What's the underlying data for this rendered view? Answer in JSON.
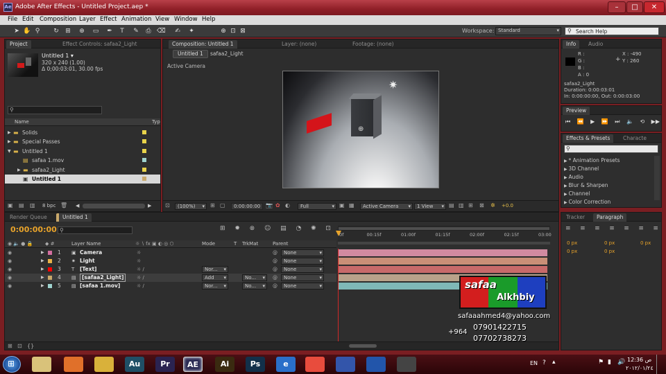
{
  "window": {
    "title": "Adobe After Effects - Untitled Project.aep *",
    "min": "–",
    "max": "□",
    "close": "✕"
  },
  "menu": [
    "File",
    "Edit",
    "Composition",
    "Layer",
    "Effect",
    "Animation",
    "View",
    "Window",
    "Help"
  ],
  "workspace": {
    "label": "Workspace:",
    "value": "Standard"
  },
  "search_help": {
    "placeholder": "Search Help"
  },
  "project": {
    "tabs": [
      "Project",
      "Effect Controls: safaa2_Light"
    ],
    "comp_name": "Untitled 1 ▾",
    "comp_size": "320 x 240 (1.00)",
    "comp_duration": "Δ 0;00:03:01, 30.00 fps",
    "col_name": "Name",
    "col_type": "Typ",
    "items": [
      {
        "name": "Solids",
        "kind": "folder",
        "color": "#e8d34a"
      },
      {
        "name": "Special Passes",
        "kind": "folder",
        "color": "#e8d34a"
      },
      {
        "name": "Untitled 1",
        "kind": "folder",
        "color": "#e8d34a"
      },
      {
        "name": "safaa 1.mov",
        "kind": "file",
        "color": "#9fd3cf"
      },
      {
        "name": "safaa2_Light",
        "kind": "folder",
        "color": "#e8d34a"
      },
      {
        "name": "Untitled 1",
        "kind": "comp",
        "color": "#c9a86a"
      }
    ],
    "bpc": "8 bpc"
  },
  "composition": {
    "tabs": [
      "Composition: Untitled 1",
      "Layer: (none)",
      "Footage: (none)"
    ],
    "subtab": "Untitled 1",
    "breadcrumb": "safaa2_Light",
    "view_label": "Active Camera",
    "zoom": "(100%)",
    "time": "0:00:00:00",
    "resolution": "Full",
    "camera": "Active Camera",
    "views": "1 View",
    "exposure": "+0.0"
  },
  "info": {
    "tabs": [
      "Info",
      "Audio"
    ],
    "R": "R :",
    "G": "G :",
    "B": "B :",
    "A": "A : 0",
    "X": "X : -490",
    "Y": "Y : 260",
    "layer": "safaa2_Light",
    "duration": "Duration: 0:00:03:01",
    "inout": "In: 0:00:00:00, Out: 0:00:03:00"
  },
  "preview": {
    "tab": "Preview"
  },
  "effects": {
    "tabs": [
      "Effects & Presets",
      "Characte"
    ],
    "items": [
      "* Animation Presets",
      "3D Channel",
      "Audio",
      "Blur & Sharpen",
      "Channel",
      "Color Correction"
    ]
  },
  "paragraph": {
    "tabs": [
      "Tracker",
      "Paragraph"
    ],
    "vals": [
      "0 px",
      "0 px",
      "0 px",
      "0 px",
      "0 px"
    ]
  },
  "timeline": {
    "tabs": [
      "Render Queue",
      "Untitled 1"
    ],
    "time": "0:00:00:00",
    "col_layer": "Layer Name",
    "col_mode": "Mode",
    "col_t": "T",
    "col_trk": "TrkMat",
    "col_parent": "Parent",
    "ruler": [
      "0f",
      "00:15f",
      "01:00f",
      "01:15f",
      "02:00f",
      "02:15f",
      "03:00"
    ],
    "layers": [
      {
        "num": "1",
        "name": "Camera",
        "mode": "",
        "trk": "",
        "parent": "None",
        "color": "#d46fa0",
        "bar": "#d18aa0"
      },
      {
        "num": "2",
        "name": "Light",
        "mode": "",
        "trk": "",
        "parent": "None",
        "color": "#e8b24a",
        "bar": "#c98f77"
      },
      {
        "num": "3",
        "name": "[Text]",
        "mode": "Nor...",
        "trk": "",
        "parent": "None",
        "color": "#ff0000",
        "bar": "#c76a6a"
      },
      {
        "num": "4",
        "name": "[safaa2_Light]",
        "mode": "Add",
        "trk": "No...",
        "parent": "None",
        "color": "#c9a86a",
        "bar": "#b8a28a"
      },
      {
        "num": "5",
        "name": "[safaa 1.mov]",
        "mode": "Nor...",
        "trk": "No...",
        "parent": "None",
        "color": "#9fd3cf",
        "bar": "#7fb8b8"
      }
    ]
  },
  "watermark": {
    "line1": "safaa",
    "line2": "Alkhbiy",
    "email": "safaaahmed4@yahoo.com",
    "phone1": "07901422715",
    "prefix": "+964",
    "phone2": "07702738273"
  },
  "taskbar": {
    "lang": "EN",
    "time": "12:36 ص",
    "date": "٢٠١٢/٠١/٢٤",
    "apps": [
      {
        "label": "",
        "bg": "#d9c27a"
      },
      {
        "label": "",
        "bg": "#e0702a"
      },
      {
        "label": "",
        "bg": "#d9b13a"
      },
      {
        "label": "Au",
        "bg": "#1f4f66"
      },
      {
        "label": "Pr",
        "bg": "#2a2350"
      },
      {
        "label": "AE",
        "bg": "#2b2b54"
      },
      {
        "label": "Ai",
        "bg": "#3a2a10"
      },
      {
        "label": "Ps",
        "bg": "#12304a"
      },
      {
        "label": "e",
        "bg": "#2a6fc9"
      },
      {
        "label": "",
        "bg": "#e84c3d"
      },
      {
        "label": "",
        "bg": "#3355aa"
      },
      {
        "label": "",
        "bg": "#2255aa"
      },
      {
        "label": "",
        "bg": "#444"
      }
    ]
  }
}
